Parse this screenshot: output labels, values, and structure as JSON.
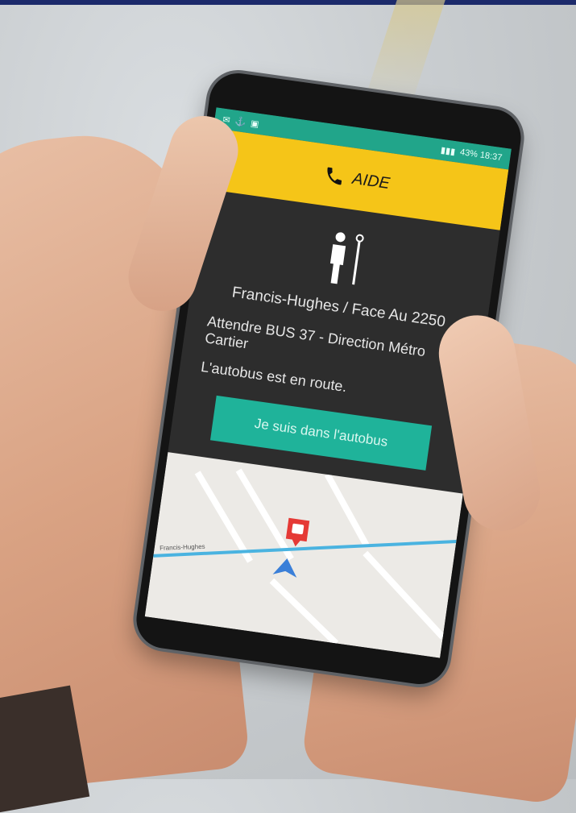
{
  "status_bar": {
    "left_icons": [
      "message-icon",
      "usb-icon",
      "image-icon"
    ],
    "right_text": "43%  18:37"
  },
  "help_button": {
    "label": "AIDE",
    "icon": "phone-icon"
  },
  "stop": {
    "icon": "bus-stop-person-icon",
    "name": "Francis-Hughes / Face Au 2250"
  },
  "instruction": "Attendre BUS 37 - Direction Métro Cartier",
  "status_text": "L'autobus est en route.",
  "action_button": {
    "label": "Je suis dans l'autobus"
  },
  "map": {
    "street_label": "Francis-Hughes",
    "bus_marker": "bus-stop-marker-icon",
    "location_marker": "navigation-arrow-icon",
    "colors": {
      "route": "#4ab3e0",
      "marker": "#e53935",
      "arrow": "#3a7fd8"
    }
  },
  "colors": {
    "accent_yellow": "#f5c518",
    "accent_teal": "#1fb39a",
    "status_teal": "#21a58a",
    "screen_bg": "#2d2d2d"
  }
}
